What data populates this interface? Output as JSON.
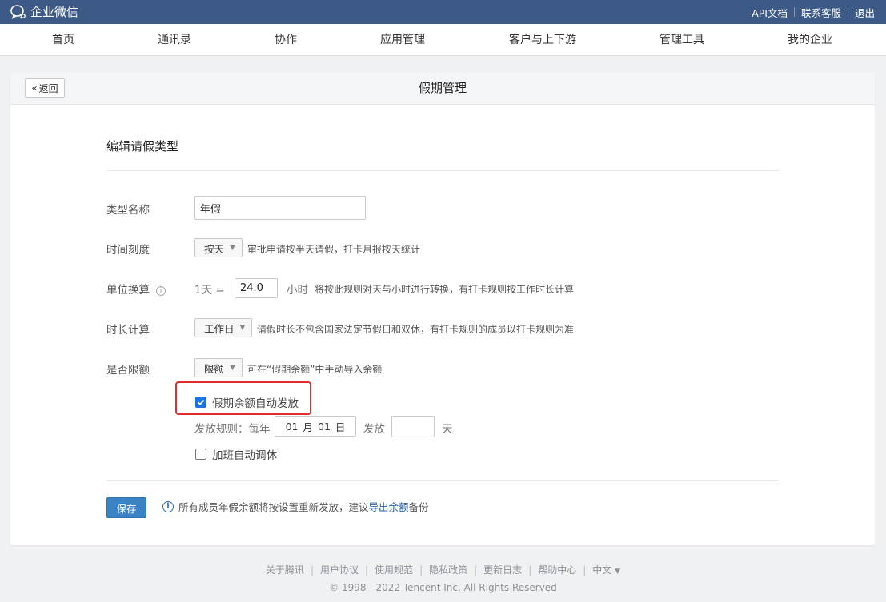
{
  "brand": {
    "name": "企业微信"
  },
  "top_links": [
    {
      "label": "API文档"
    },
    {
      "label": "联系客服"
    },
    {
      "label": "退出"
    }
  ],
  "nav": [
    {
      "label": "首页"
    },
    {
      "label": "通讯录"
    },
    {
      "label": "协作"
    },
    {
      "label": "应用管理"
    },
    {
      "label": "客户与上下游"
    },
    {
      "label": "管理工具"
    },
    {
      "label": "我的企业"
    }
  ],
  "page": {
    "back_label": "返回",
    "title": "假期管理",
    "section_title": "编辑请假类型"
  },
  "form": {
    "type_name": {
      "label": "类型名称",
      "value": "年假"
    },
    "time_unit": {
      "label": "时间刻度",
      "selected": "按天",
      "hint": "审批申请按半天请假，打卡月报按天统计"
    },
    "conversion": {
      "label": "单位换算",
      "prefix": "1天 =",
      "value": "24.0",
      "unit": "小时",
      "hint": "将按此规则对天与小时进行转换，有打卡规则按工作时长计算"
    },
    "duration_calc": {
      "label": "时长计算",
      "selected": "工作日",
      "hint": "请假时长不包含国家法定节假日和双休，有打卡规则的成员以打卡规则为准"
    },
    "quota": {
      "label": "是否限额",
      "selected": "限额",
      "hint": "可在“假期余额”中手动导入余额"
    },
    "auto_issue": {
      "label": "假期余额自动发放",
      "checked": true
    },
    "issue_rule": {
      "label": "发放规则：每年",
      "month": "01",
      "month_unit": "月",
      "day": "01",
      "day_unit": "日",
      "issue_label": "发放",
      "amount": "",
      "amount_unit": "天"
    },
    "overtime": {
      "label": "加班自动调休",
      "checked": false
    }
  },
  "actions": {
    "save_label": "保存",
    "note_prefix": "所有成员年假余额将按设置重新发放，建议",
    "note_link": "导出余额",
    "note_suffix": "备份"
  },
  "footer": {
    "links": [
      {
        "label": "关于腾讯"
      },
      {
        "label": "用户协议"
      },
      {
        "label": "使用规范"
      },
      {
        "label": "隐私政策"
      },
      {
        "label": "更新日志"
      },
      {
        "label": "帮助中心"
      },
      {
        "label": "中文"
      }
    ],
    "copyright": "© 1998 - 2022 Tencent Inc. All Rights Reserved"
  },
  "colors": {
    "topbar": "#3d5a87",
    "primary": "#3a84c6",
    "highlight": "#e02c2c",
    "checkbox": "#1a73e8"
  }
}
